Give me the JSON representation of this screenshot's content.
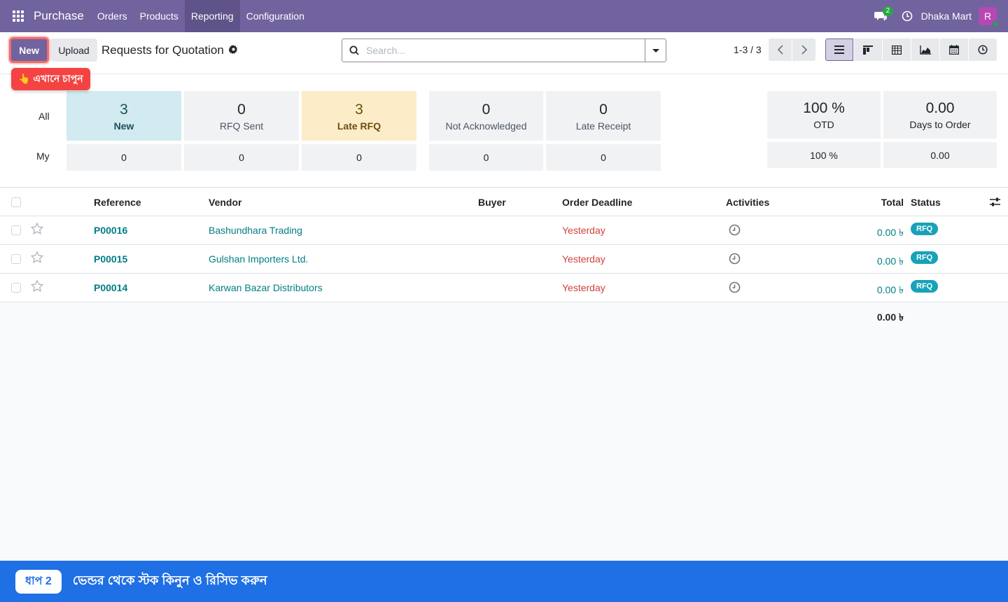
{
  "navbar": {
    "app_name": "Purchase",
    "menu": [
      "Orders",
      "Products",
      "Reporting",
      "Configuration"
    ],
    "active_menu": "Reporting",
    "chat_count": "2",
    "company": "Dhaka Mart",
    "avatar_letter": "R",
    "accent": "#71639e"
  },
  "control": {
    "new_label": "New",
    "upload_label": "Upload",
    "title": "Requests for Quotation",
    "search_placeholder": "Search...",
    "pager": "1-3 / 3"
  },
  "tooltip": "👆 এখানে চাপুন",
  "dashboard": {
    "row_all": "All",
    "row_my": "My",
    "tiles": [
      {
        "num": "3",
        "label": "New",
        "my": "0"
      },
      {
        "num": "0",
        "label": "RFQ Sent",
        "my": "0"
      },
      {
        "num": "3",
        "label": "Late RFQ",
        "my": "0"
      },
      {
        "num": "0",
        "label": "Not Acknowledged",
        "my": "0"
      },
      {
        "num": "0",
        "label": "Late Receipt",
        "my": "0"
      }
    ],
    "kpis": [
      {
        "num": "100 %",
        "label": "OTD",
        "my": "100 %"
      },
      {
        "num": "0.00",
        "label": "Days to Order",
        "my": "0.00"
      }
    ]
  },
  "table": {
    "headers": {
      "reference": "Reference",
      "vendor": "Vendor",
      "buyer": "Buyer",
      "deadline": "Order Deadline",
      "activities": "Activities",
      "total": "Total",
      "status": "Status"
    },
    "rows": [
      {
        "reference": "P00016",
        "vendor": "Bashundhara Trading",
        "deadline": "Yesterday",
        "total": "0.00 ৳",
        "status": "RFQ"
      },
      {
        "reference": "P00015",
        "vendor": "Gulshan Importers Ltd.",
        "deadline": "Yesterday",
        "total": "0.00 ৳",
        "status": "RFQ"
      },
      {
        "reference": "P00014",
        "vendor": "Karwan Bazar Distributors",
        "deadline": "Yesterday",
        "total": "0.00 ৳",
        "status": "RFQ"
      }
    ],
    "grand_total": "0.00 ৳"
  },
  "banner": {
    "step": "ধাপ 2",
    "text": "ভেন্ডর থেকে স্টক কিনুন ও রিসিভ করুন"
  }
}
